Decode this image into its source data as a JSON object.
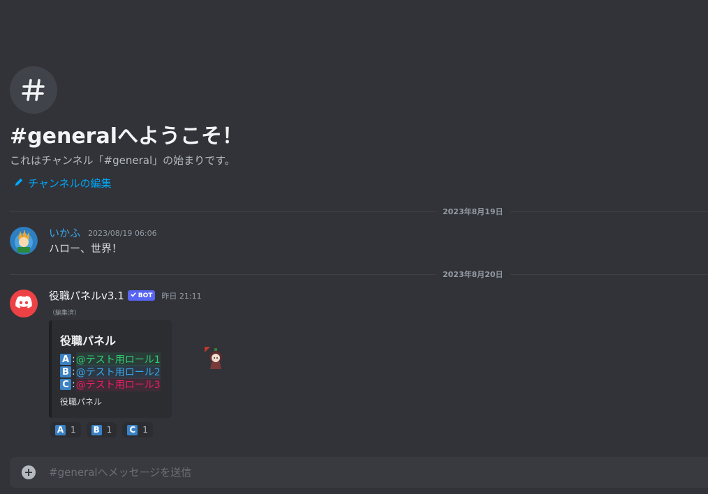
{
  "welcome": {
    "title": "#generalへようこそ！",
    "subtitle": "これはチャンネル「#general」の始まりです。",
    "edit_link": "チャンネルの編集"
  },
  "dividers": [
    "2023年8月19日",
    "2023年8月20日"
  ],
  "messages": [
    {
      "username": "いかふ",
      "username_color": "#3ca4e8",
      "timestamp": "2023/08/19 06:06",
      "text": "ハロー、世界！"
    },
    {
      "username": "役職パネルv3.1",
      "bot_tag": "BOT",
      "timestamp": "昨日 21:11",
      "edited": "（編集済）",
      "embed": {
        "title": "役職パネル",
        "roles": [
          {
            "letter": "A",
            "role": "@テスト用ロール1",
            "color": "#2ecc71"
          },
          {
            "letter": "B",
            "role": "@テスト用ロール2",
            "color": "#3ca4e8"
          },
          {
            "letter": "C",
            "role": "@テスト用ロール3",
            "color": "#e91e63"
          }
        ],
        "footer": "役職パネル"
      },
      "reactions": [
        {
          "letter": "A",
          "count": "1"
        },
        {
          "letter": "B",
          "count": "1"
        },
        {
          "letter": "C",
          "count": "1"
        }
      ]
    }
  ],
  "input": {
    "placeholder": "#generalへメッセージを送信"
  },
  "colors": {
    "background": "#313338",
    "link": "#00a8fc",
    "blurple": "#5865f2",
    "discord_red": "#ed4245"
  }
}
